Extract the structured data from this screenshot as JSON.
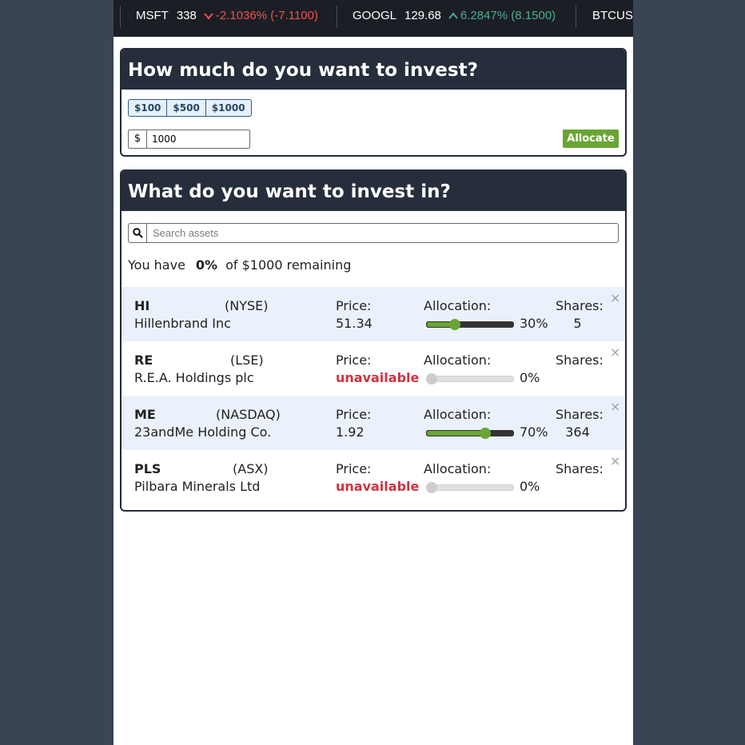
{
  "ticker": [
    {
      "symbol": "MSFT",
      "price": "338",
      "direction": "down",
      "change": "-2.1036% (-7.1100)"
    },
    {
      "symbol": "GOOGL",
      "price": "129.68",
      "direction": "up",
      "change": "6.2847% (8.1500)"
    },
    {
      "symbol": "BTCUS",
      "price": "",
      "direction": "",
      "change": ""
    }
  ],
  "invest_amount": {
    "title": "How much do you want to invest?",
    "presets": [
      "$100",
      "$500",
      "$1000"
    ],
    "currency_symbol": "$",
    "amount_value": "1000",
    "allocate_label": "Allocate"
  },
  "invest_in": {
    "title": "What do you want to invest in?",
    "search_placeholder": "Search assets",
    "remaining_prefix": "You have",
    "remaining_pct": "0%",
    "remaining_suffix": "of $1000 remaining"
  },
  "labels": {
    "price": "Price:",
    "allocation": "Allocation:",
    "shares": "Shares:",
    "close": "×"
  },
  "assets": [
    {
      "ticker": "HI",
      "exchange": "(NYSE)",
      "name": "Hillenbrand Inc",
      "price": "51.34",
      "price_available": true,
      "allocation_pct": "30%",
      "allocation_value": 30,
      "shares": "5"
    },
    {
      "ticker": "RE",
      "exchange": "(LSE)",
      "name": "R.E.A. Holdings plc",
      "price": "unavailable",
      "price_available": false,
      "allocation_pct": "0%",
      "allocation_value": 0,
      "shares": ""
    },
    {
      "ticker": "ME",
      "exchange": "(NASDAQ)",
      "name": "23andMe Holding Co.",
      "price": "1.92",
      "price_available": true,
      "allocation_pct": "70%",
      "allocation_value": 70,
      "shares": "364"
    },
    {
      "ticker": "PLS",
      "exchange": "(ASX)",
      "name": "Pilbara Minerals Ltd",
      "price": "unavailable",
      "price_available": false,
      "allocation_pct": "0%",
      "allocation_value": 0,
      "shares": ""
    }
  ],
  "colors": {
    "accent_green": "#6aa534",
    "negative": "#ef5350",
    "positive": "#4caf91",
    "unavailable": "#d03240",
    "header_bg": "#262e3b"
  }
}
